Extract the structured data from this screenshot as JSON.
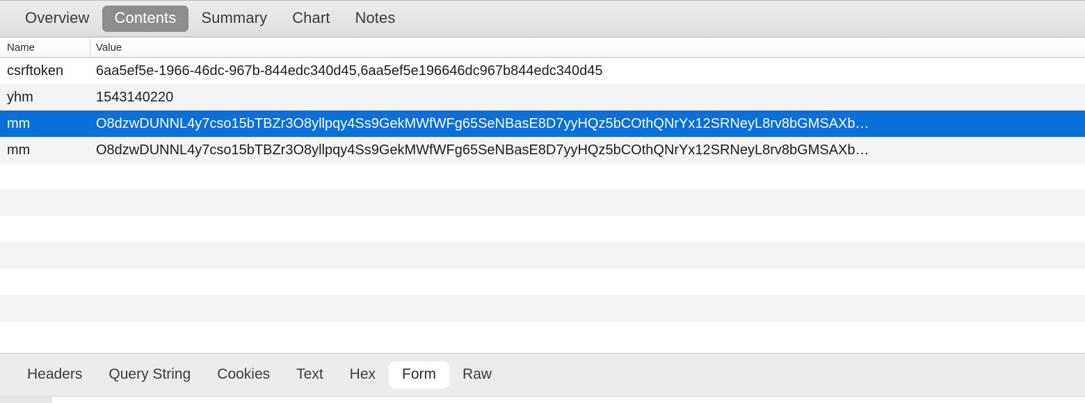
{
  "top_tabs": {
    "items": [
      {
        "label": "Overview",
        "active": false
      },
      {
        "label": "Contents",
        "active": true
      },
      {
        "label": "Summary",
        "active": false
      },
      {
        "label": "Chart",
        "active": false
      },
      {
        "label": "Notes",
        "active": false
      }
    ]
  },
  "table": {
    "columns": [
      {
        "label": "Name"
      },
      {
        "label": "Value"
      }
    ],
    "rows": [
      {
        "name": "csrftoken",
        "value": "6aa5ef5e-1966-46dc-967b-844edc340d45,6aa5ef5e196646dc967b844edc340d45",
        "selected": false
      },
      {
        "name": "yhm",
        "value": "1543140220",
        "selected": false
      },
      {
        "name": "mm",
        "value": "O8dzwDUNNL4y7cso15bTBZr3O8yllpqy4Ss9GekMWfWFg65SeNBasE8D7yyHQz5bCOthQNrYx12SRNeyL8rv8bGMSAXb…",
        "selected": true
      },
      {
        "name": "mm",
        "value": "O8dzwDUNNL4y7cso15bTBZr3O8yllpqy4Ss9GekMWfWFg65SeNBasE8D7yyHQz5bCOthQNrYx12SRNeyL8rv8bGMSAXb…",
        "selected": false
      }
    ],
    "empty_row_count": 7
  },
  "bottom_tabs": {
    "items": [
      {
        "label": "Headers",
        "active": false
      },
      {
        "label": "Query String",
        "active": false
      },
      {
        "label": "Cookies",
        "active": false
      },
      {
        "label": "Text",
        "active": false
      },
      {
        "label": "Hex",
        "active": false
      },
      {
        "label": "Form",
        "active": true
      },
      {
        "label": "Raw",
        "active": false
      }
    ]
  },
  "colors": {
    "selection_blue": "#0a6fd8",
    "active_tab_gray": "#8d8d8d",
    "row_stripe": "#f4f4f4",
    "toolbar_bg": "#ececec"
  }
}
